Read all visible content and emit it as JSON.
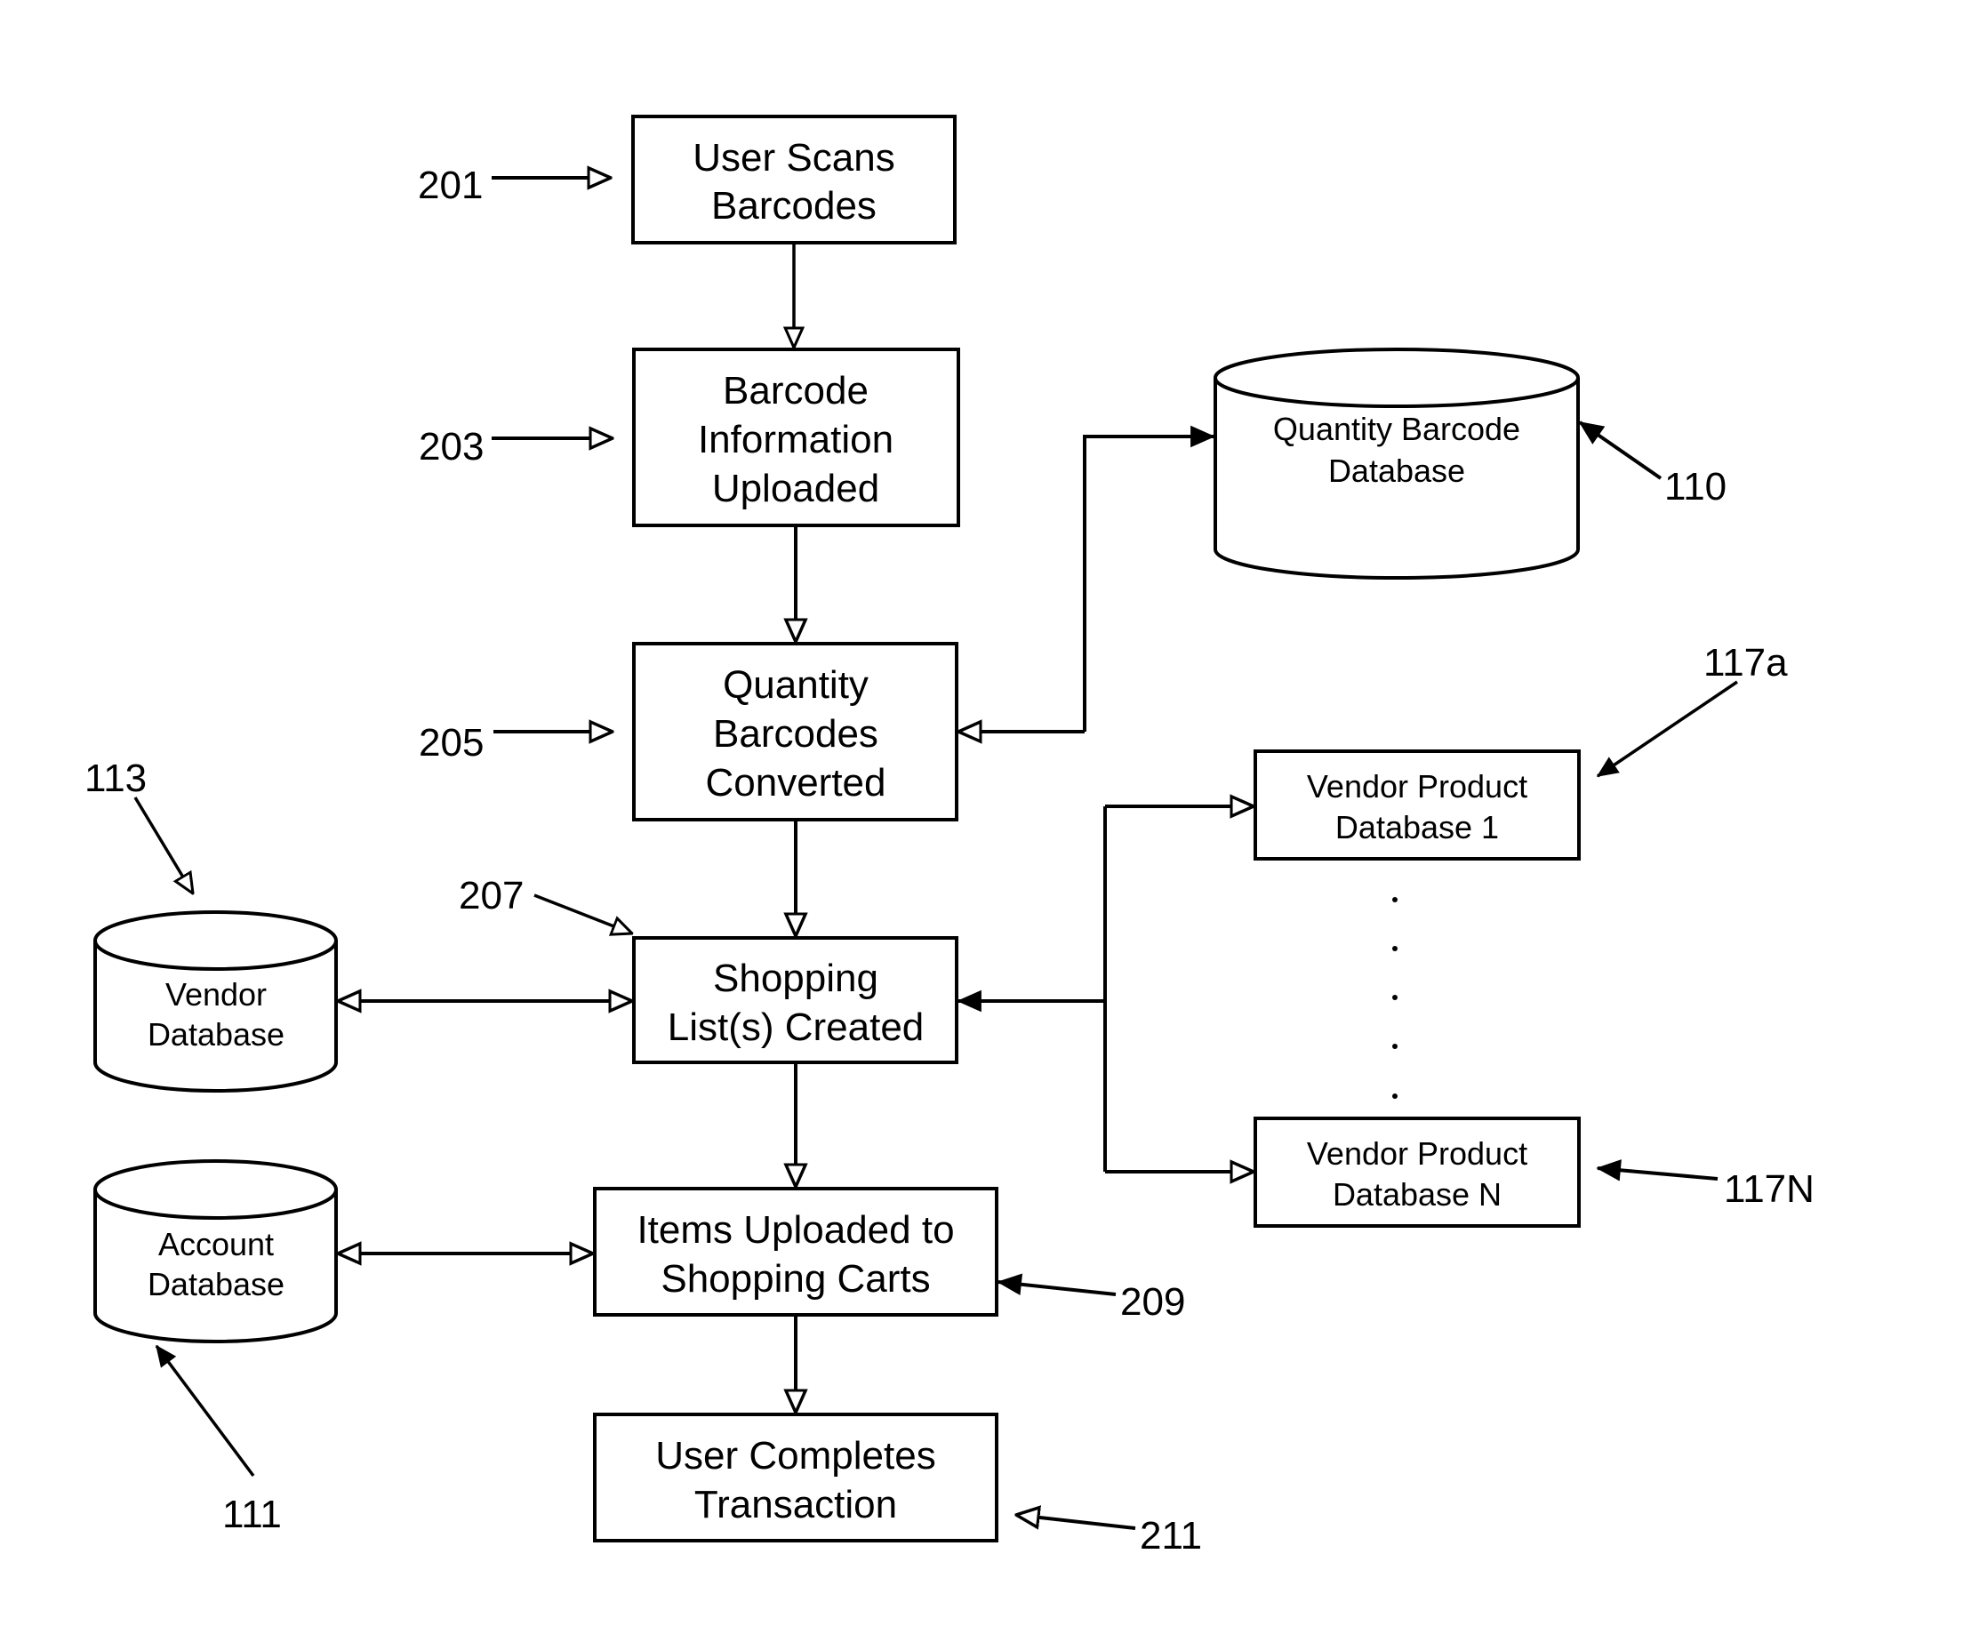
{
  "diagram": {
    "type": "flowchart",
    "process_steps": [
      {
        "id": "201",
        "lines": [
          "User Scans",
          "Barcodes"
        ]
      },
      {
        "id": "203",
        "lines": [
          "Barcode",
          "Information",
          "Uploaded"
        ]
      },
      {
        "id": "205",
        "lines": [
          "Quantity",
          "Barcodes",
          "Converted"
        ]
      },
      {
        "id": "207",
        "lines": [
          "Shopping",
          "List(s) Created"
        ]
      },
      {
        "id": "209",
        "lines": [
          "Items Uploaded to",
          "Shopping Carts"
        ]
      },
      {
        "id": "211",
        "lines": [
          "User Completes",
          "Transaction"
        ]
      }
    ],
    "databases": [
      {
        "id": "110",
        "lines": [
          "Quantity Barcode",
          "Database"
        ]
      },
      {
        "id": "113",
        "lines": [
          "Vendor",
          "Database"
        ]
      },
      {
        "id": "111",
        "lines": [
          "Account",
          "Database"
        ]
      }
    ],
    "vendor_product_databases": [
      {
        "id": "117a",
        "lines": [
          "Vendor Product",
          "Database 1"
        ]
      },
      {
        "id": "117N",
        "lines": [
          "Vendor Product",
          "Database N"
        ]
      }
    ],
    "reference_labels": {
      "r201": "201",
      "r203": "203",
      "r205": "205",
      "r207": "207",
      "r209": "209",
      "r211": "211",
      "r110": "110",
      "r113": "113",
      "r111": "111",
      "r117a": "117a",
      "r117N": "117N"
    },
    "connections": [
      {
        "from": "201",
        "to": "203",
        "direction": "one-way"
      },
      {
        "from": "203",
        "to": "205",
        "direction": "one-way"
      },
      {
        "from": "205",
        "to": "110",
        "direction": "two-way"
      },
      {
        "from": "205",
        "to": "207",
        "direction": "one-way"
      },
      {
        "from": "207",
        "to": "113",
        "direction": "two-way"
      },
      {
        "from": "207",
        "to": "117a",
        "direction": "two-way"
      },
      {
        "from": "207",
        "to": "117N",
        "direction": "two-way"
      },
      {
        "from": "207",
        "to": "209",
        "direction": "one-way"
      },
      {
        "from": "209",
        "to": "111",
        "direction": "two-way"
      },
      {
        "from": "209",
        "to": "211",
        "direction": "one-way"
      }
    ],
    "ellipsis": "vertical dots between Vendor Product Database 1 and Database N"
  }
}
